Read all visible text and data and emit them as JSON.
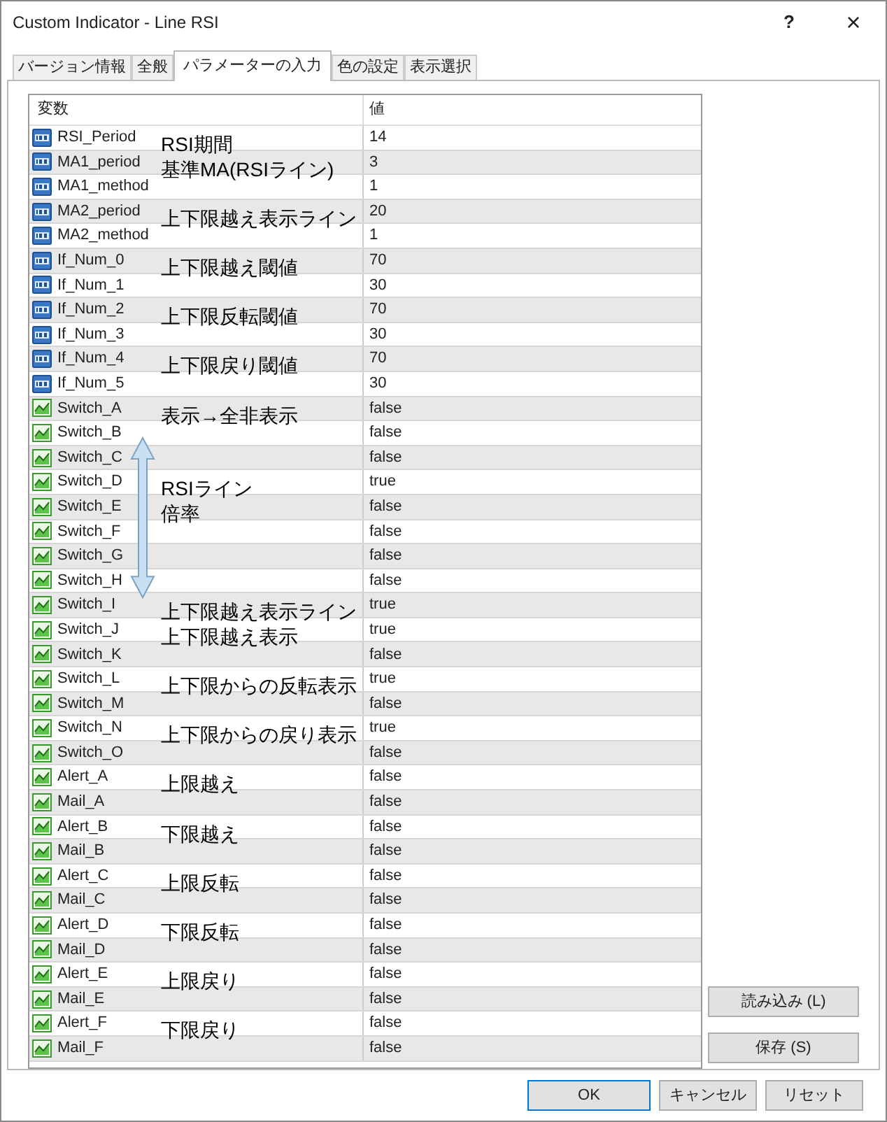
{
  "window": {
    "title": "Custom Indicator - Line RSI",
    "help": "?",
    "close": "×"
  },
  "tabs": [
    {
      "label": "バージョン情報",
      "selected": false
    },
    {
      "label": "全般",
      "selected": false
    },
    {
      "label": "パラメーターの入力",
      "selected": true
    },
    {
      "label": "色の設定",
      "selected": false
    },
    {
      "label": "表示選択",
      "selected": false
    }
  ],
  "table": {
    "columns": [
      "変数",
      "値"
    ],
    "rows": [
      {
        "kind": "int",
        "name": "RSI_Period",
        "value": "14",
        "note": "RSI期間"
      },
      {
        "kind": "int",
        "name": "MA1_period",
        "value": "3",
        "note": "基準MA(RSIライン)"
      },
      {
        "kind": "int",
        "name": "MA1_method",
        "value": "1"
      },
      {
        "kind": "int",
        "name": "MA2_period",
        "value": "20",
        "note": "上下限越え表示ライン"
      },
      {
        "kind": "int",
        "name": "MA2_method",
        "value": "1"
      },
      {
        "kind": "int",
        "name": "If_Num_0",
        "value": "70",
        "note": "上下限越え閾値"
      },
      {
        "kind": "int",
        "name": "If_Num_1",
        "value": "30"
      },
      {
        "kind": "int",
        "name": "If_Num_2",
        "value": "70",
        "note": "上下限反転閾値"
      },
      {
        "kind": "int",
        "name": "If_Num_3",
        "value": "30"
      },
      {
        "kind": "int",
        "name": "If_Num_4",
        "value": "70",
        "note": "上下限戻り閾値"
      },
      {
        "kind": "int",
        "name": "If_Num_5",
        "value": "30"
      },
      {
        "kind": "bool",
        "name": "Switch_A",
        "value": "false",
        "note": "表示→全非表示"
      },
      {
        "kind": "bool",
        "name": "Switch_B",
        "value": "false"
      },
      {
        "kind": "bool",
        "name": "Switch_C",
        "value": "false"
      },
      {
        "kind": "bool",
        "name": "Switch_D",
        "value": "true",
        "note": "RSIライン"
      },
      {
        "kind": "bool",
        "name": "Switch_E",
        "value": "false",
        "note": "倍率"
      },
      {
        "kind": "bool",
        "name": "Switch_F",
        "value": "false"
      },
      {
        "kind": "bool",
        "name": "Switch_G",
        "value": "false"
      },
      {
        "kind": "bool",
        "name": "Switch_H",
        "value": "false"
      },
      {
        "kind": "bool",
        "name": "Switch_I",
        "value": "true",
        "note": "上下限越え表示ライン"
      },
      {
        "kind": "bool",
        "name": "Switch_J",
        "value": "true",
        "note": "上下限越え表示"
      },
      {
        "kind": "bool",
        "name": "Switch_K",
        "value": "false"
      },
      {
        "kind": "bool",
        "name": "Switch_L",
        "value": "true",
        "note": "上下限からの反転表示"
      },
      {
        "kind": "bool",
        "name": "Switch_M",
        "value": "false"
      },
      {
        "kind": "bool",
        "name": "Switch_N",
        "value": "true",
        "note": "上下限からの戻り表示"
      },
      {
        "kind": "bool",
        "name": "Switch_O",
        "value": "false"
      },
      {
        "kind": "bool",
        "name": "Alert_A",
        "value": "false",
        "note": "上限越え"
      },
      {
        "kind": "bool",
        "name": "Mail_A",
        "value": "false"
      },
      {
        "kind": "bool",
        "name": "Alert_B",
        "value": "false",
        "note": "下限越え"
      },
      {
        "kind": "bool",
        "name": "Mail_B",
        "value": "false"
      },
      {
        "kind": "bool",
        "name": "Alert_C",
        "value": "false",
        "note": "上限反転"
      },
      {
        "kind": "bool",
        "name": "Mail_C",
        "value": "false"
      },
      {
        "kind": "bool",
        "name": "Alert_D",
        "value": "false",
        "note": "下限反転"
      },
      {
        "kind": "bool",
        "name": "Mail_D",
        "value": "false"
      },
      {
        "kind": "bool",
        "name": "Alert_E",
        "value": "false",
        "note": "上限戻り"
      },
      {
        "kind": "bool",
        "name": "Mail_E",
        "value": "false"
      },
      {
        "kind": "bool",
        "name": "Alert_F",
        "value": "false",
        "note": "下限戻り"
      },
      {
        "kind": "bool",
        "name": "Mail_F",
        "value": "false"
      }
    ]
  },
  "side_buttons": [
    "読み込み (L)",
    "保存 (S)"
  ],
  "buttons": [
    "OK",
    "キャンセル",
    "リセット"
  ]
}
